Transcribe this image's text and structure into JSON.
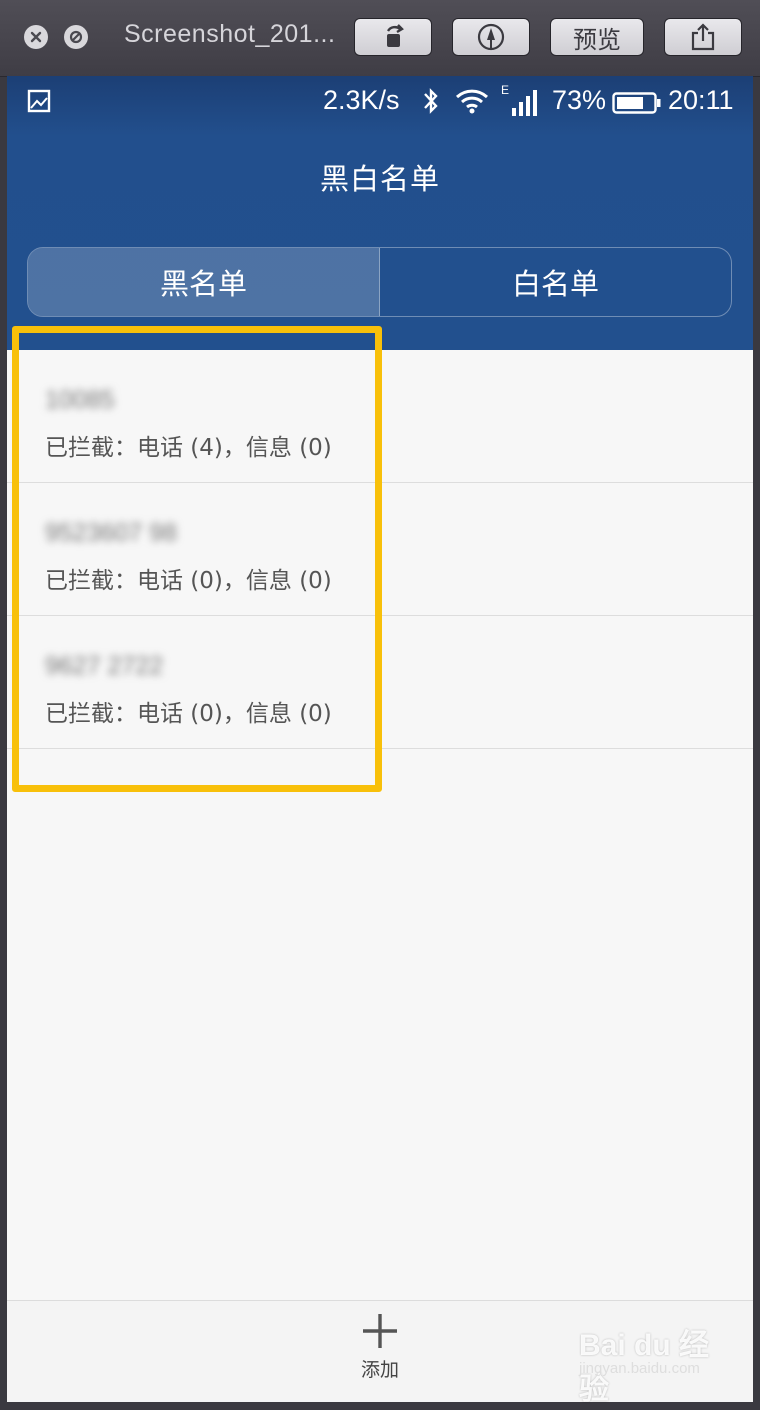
{
  "window": {
    "title": "Screenshot_201...",
    "preview_button": "预览"
  },
  "statusbar": {
    "speed": "2.3K/s",
    "network_type": "E",
    "battery_pct": "73%",
    "battery_level": 0.73,
    "time": "20:11"
  },
  "app": {
    "title": "黑白名单"
  },
  "tabs": [
    {
      "label": "黑名单",
      "active": true
    },
    {
      "label": "白名单",
      "active": false
    }
  ],
  "list": {
    "items": [
      {
        "number": "10085",
        "stats": "已拦截：电话 (4)，信息 (0)"
      },
      {
        "number": "9523607 98",
        "stats": "已拦截：电话 (0)，信息 (0)"
      },
      {
        "number": "9627 2722",
        "stats": "已拦截：电话 (0)，信息 (0)"
      }
    ]
  },
  "bottom": {
    "add_label": "添加"
  },
  "watermark": {
    "main": "Bai du 经验",
    "sub": "jingyan.baidu.com"
  },
  "colors": {
    "header": "#22508e",
    "highlight": "#f8c00a",
    "background": "#f7f7f7"
  }
}
